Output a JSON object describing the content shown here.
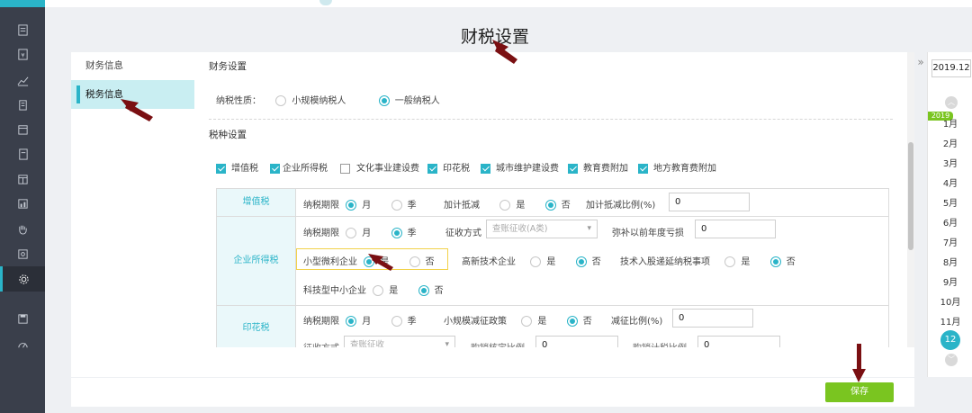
{
  "page": {
    "title": "财税设置"
  },
  "sidebar_tabs": [
    "财务信息",
    "税务信息"
  ],
  "finance_section": {
    "title": "财务设置",
    "tax_nature_label": "纳税性质：",
    "options": [
      "小规模纳税人",
      "一般纳税人"
    ],
    "selected": "一般纳税人"
  },
  "tax_types_section": {
    "title": "税种设置",
    "items": [
      {
        "label": "增值税",
        "checked": true
      },
      {
        "label": "企业所得税",
        "checked": true
      },
      {
        "label": "文化事业建设费",
        "checked": false
      },
      {
        "label": "印花税",
        "checked": true
      },
      {
        "label": "城市维护建设费",
        "checked": true
      },
      {
        "label": "教育费附加",
        "checked": true
      },
      {
        "label": "地方教育费附加",
        "checked": true
      }
    ]
  },
  "vat": {
    "name": "增值税",
    "period_label": "纳税期限",
    "period_opt1": "月",
    "period_opt2": "季",
    "extra_label": "加计抵减",
    "yes": "是",
    "no": "否",
    "ratio_label": "加计抵减比例(%)",
    "ratio_value": "0"
  },
  "cit": {
    "name": "企业所得税",
    "period_label": "纳税期限",
    "period_opt1": "月",
    "period_opt2": "季",
    "method_label": "征收方式",
    "method_value": "查账征收(A类)",
    "loss_label": "弥补以前年度亏损",
    "loss_value": "0",
    "small_label": "小型微利企业",
    "hitech_label": "高新技术企业",
    "tech_invest_label": "技术入股递延纳税事项",
    "sme_label": "科技型中小企业",
    "yes": "是",
    "no": "否"
  },
  "stamp": {
    "name": "印花税",
    "period_label": "纳税期限",
    "period_opt1": "月",
    "period_opt2": "季",
    "policy_label": "小规模减征政策",
    "yes": "是",
    "no": "否",
    "reduce_label": "减征比例(%)",
    "reduce_value": "0",
    "partial_method": "征收方式",
    "partial_method_value": "查账征收",
    "partial_ratio1": "购销核定比例",
    "partial_ratio1_value": "0",
    "partial_ratio2": "购销计税比例",
    "partial_ratio2_value": "0"
  },
  "footer": {
    "save_label": "保存"
  },
  "month_panel": {
    "year_label": "2019.12",
    "year_tag": "2019",
    "months": [
      "1月",
      "2月",
      "3月",
      "4月",
      "5月",
      "6月",
      "7月",
      "8月",
      "9月",
      "10月",
      "11月",
      "12月"
    ],
    "selected_month": "12月"
  },
  "colors": {
    "accent": "#2ab4c8",
    "save": "#7ac520",
    "rail": "#3a3f4b",
    "annotation_arrow": "#7a0f12"
  }
}
